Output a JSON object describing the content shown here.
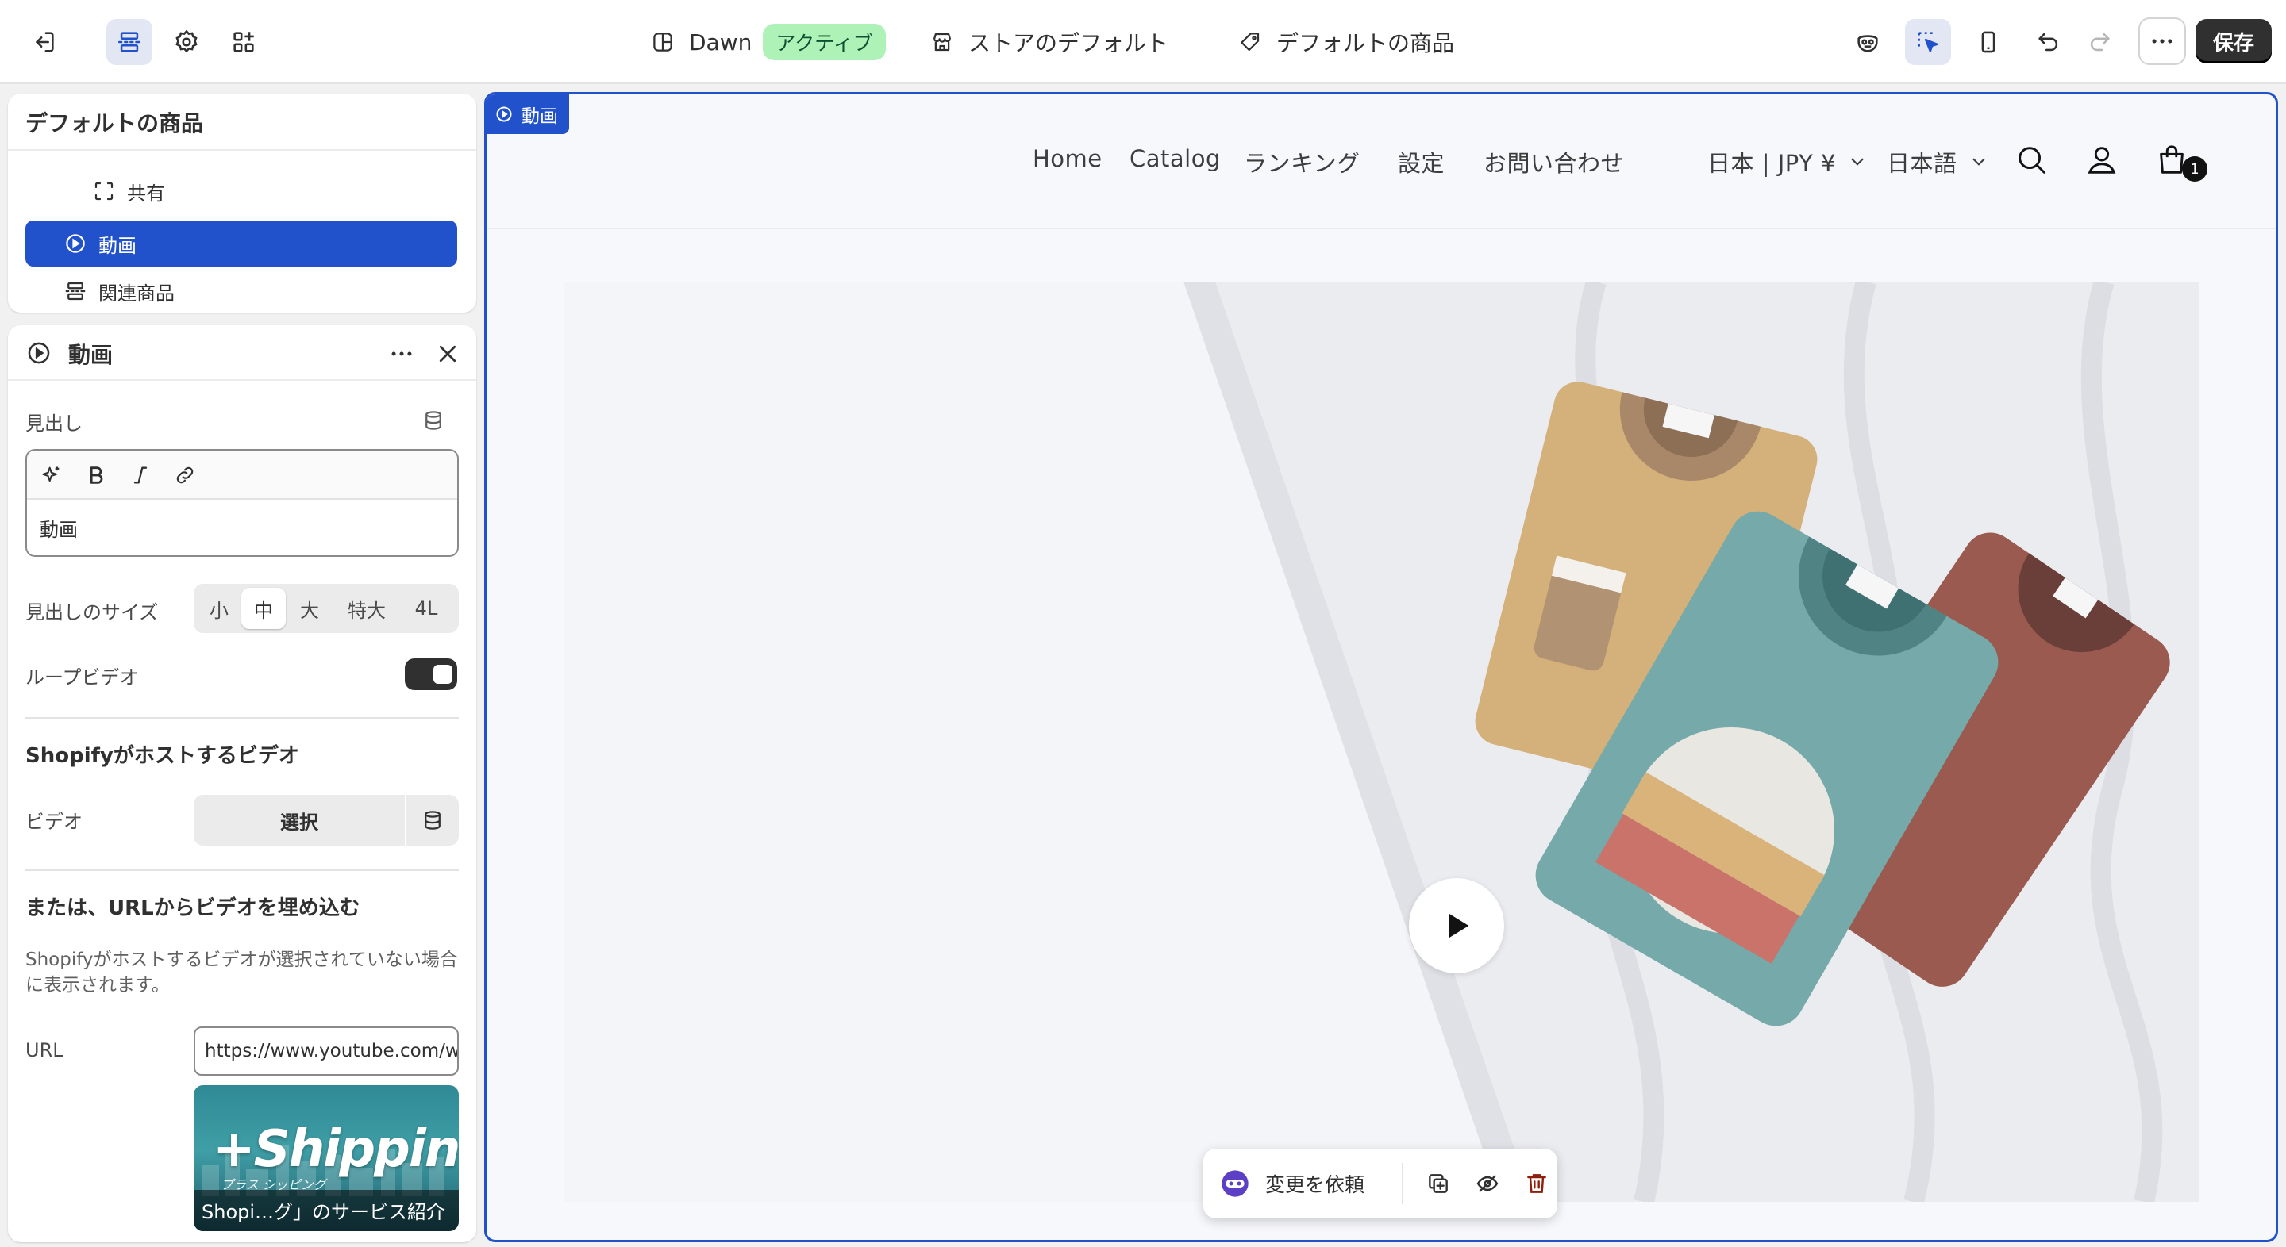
{
  "topbar": {
    "theme_name": "Dawn",
    "theme_status": "アクティブ",
    "template_store": "ストアのデフォルト",
    "template_product": "デフォルトの商品",
    "save_label": "保存"
  },
  "tree": {
    "title": "デフォルトの商品",
    "items": [
      {
        "label": "共有",
        "icon": "dashed-frame-icon"
      },
      {
        "label": "動画",
        "icon": "play-circle-icon",
        "selected": true
      },
      {
        "label": "関連商品",
        "icon": "section-icon"
      }
    ]
  },
  "settings": {
    "title": "動画",
    "heading_label": "見出し",
    "heading_value": "動画",
    "heading_size_label": "見出しのサイズ",
    "heading_sizes": [
      "小",
      "中",
      "大",
      "特大",
      "4L"
    ],
    "heading_size_selected": "中",
    "loop_label": "ループビデオ",
    "loop_on": true,
    "hosted_section": "Shopifyがホストするビデオ",
    "video_label": "ビデオ",
    "select_label": "選択",
    "embed_section": "または、URLからビデオを埋め込む",
    "embed_help": "Shopifyがホストするビデオが選択されていない場合に表示されます。",
    "url_label": "URL",
    "url_value": "https://www.youtube.com/watch",
    "thumb_logo": "+Shipping",
    "thumb_sub": "プラス シッピング",
    "thumb_caption": "Shopi…グ」のサービス紹介"
  },
  "preview": {
    "section_tag": "動画",
    "nav": [
      "Home",
      "Catalog",
      "ランキング",
      "設定",
      "お問い合わせ"
    ],
    "currency": "日本 | JPY ¥",
    "language": "日本語",
    "cart_count": "1"
  },
  "actions": {
    "request_change": "変更を依頼"
  },
  "colors": {
    "accent": "#2152cc",
    "badge_bg": "#aff2b8",
    "badge_text": "#0c5132",
    "save_bg": "#303030",
    "delete": "#8e1f0b"
  }
}
